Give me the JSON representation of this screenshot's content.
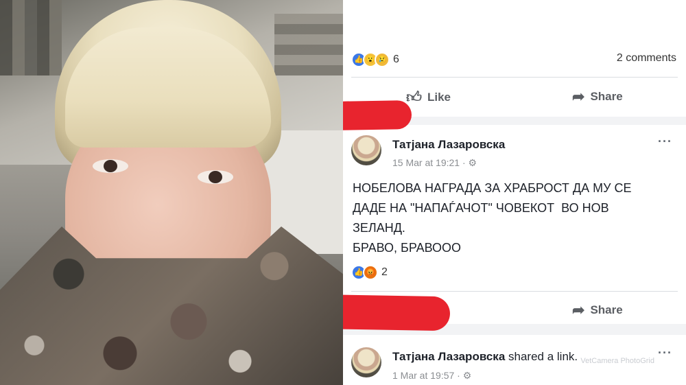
{
  "post1": {
    "reaction_icons": [
      "like-icon",
      "wow-icon",
      "sad-icon"
    ],
    "reaction_count": "6",
    "comments_label": "2 comments",
    "like_label": "Like",
    "share_label": "Share"
  },
  "post2": {
    "author": "Татјана Лазаровска",
    "timestamp": "15 Mar at 19:21 · ⚙",
    "more": "···",
    "text_lines": [
      "НОБЕЛОВА НАГРАДА ЗА ХРАБРОСТ ДА МУ СЕ",
      "ДАДЕ НА \"НАПАЃАЧОТ\" ЧОВЕКОТ  ВО НОВ",
      "ЗЕЛАНД.",
      "БРАВО, БРАВООО"
    ],
    "reaction_icons": [
      "like-icon",
      "angry-icon"
    ],
    "reaction_count": "2",
    "share_label": "Share"
  },
  "post3": {
    "author": "Татјана Лазаровска",
    "shared_text": " shared a link.",
    "timestamp": "1 Mar at 19:57 · ⚙",
    "more": "···",
    "watermark": "VetCamera PhotoGrid"
  },
  "colors": {
    "redaction": "#e8242e",
    "like_blue": "#3b78e7",
    "feed_bg": "#f2f3f5"
  }
}
